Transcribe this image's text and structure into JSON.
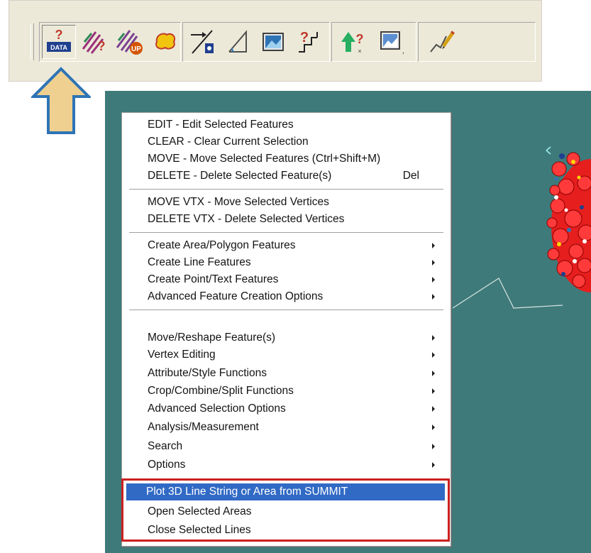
{
  "toolbar": {
    "buttons": [
      {
        "id": "data-icon",
        "pressed": true
      },
      {
        "id": "query-hatch-icon"
      },
      {
        "id": "hatch-up-icon"
      },
      {
        "id": "blob-icon"
      },
      {
        "id": "line-export-icon"
      },
      {
        "id": "angle-measure-icon"
      },
      {
        "id": "image-icon"
      },
      {
        "id": "query-step-icon"
      },
      {
        "id": "tree-query-icon"
      },
      {
        "id": "image-dropdown-icon"
      },
      {
        "id": "pencil-line-icon"
      }
    ],
    "data_icon_text": "DATA"
  },
  "menu": {
    "group1": [
      {
        "label": "EDIT - Edit Selected Features"
      },
      {
        "label": "CLEAR - Clear Current Selection"
      },
      {
        "label": "MOVE - Move Selected Features (Ctrl+Shift+M)"
      },
      {
        "label": "DELETE - Delete Selected Feature(s)",
        "shortcut": "Del"
      }
    ],
    "group2": [
      {
        "label": "MOVE VTX - Move Selected Vertices"
      },
      {
        "label": "DELETE VTX - Delete Selected Vertices"
      }
    ],
    "group3": [
      {
        "label": "Create Area/Polygon Features"
      },
      {
        "label": "Create Line Features"
      },
      {
        "label": "Create Point/Text Features"
      },
      {
        "label": "Advanced Feature Creation Options"
      }
    ],
    "group4": [
      {
        "label": "Move/Reshape Feature(s)"
      },
      {
        "label": "Vertex Editing"
      },
      {
        "label": "Attribute/Style Functions"
      },
      {
        "label": "Crop/Combine/Split Functions"
      },
      {
        "label": "Advanced Selection Options"
      },
      {
        "label": "Analysis/Measurement"
      },
      {
        "label": "Search"
      },
      {
        "label": "Options"
      }
    ],
    "group5": [
      {
        "label": "Plot 3D Line String or Area from SUMMIT"
      },
      {
        "label": "Open Selected Areas"
      },
      {
        "label": "Close Selected Lines"
      }
    ]
  },
  "colors": {
    "canvas": "#3f7a7a",
    "menu_highlight": "#316ac5",
    "annotation_box": "#cc1f1f",
    "arrow_fill": "#f0d090",
    "arrow_stroke": "#2e74b5"
  }
}
